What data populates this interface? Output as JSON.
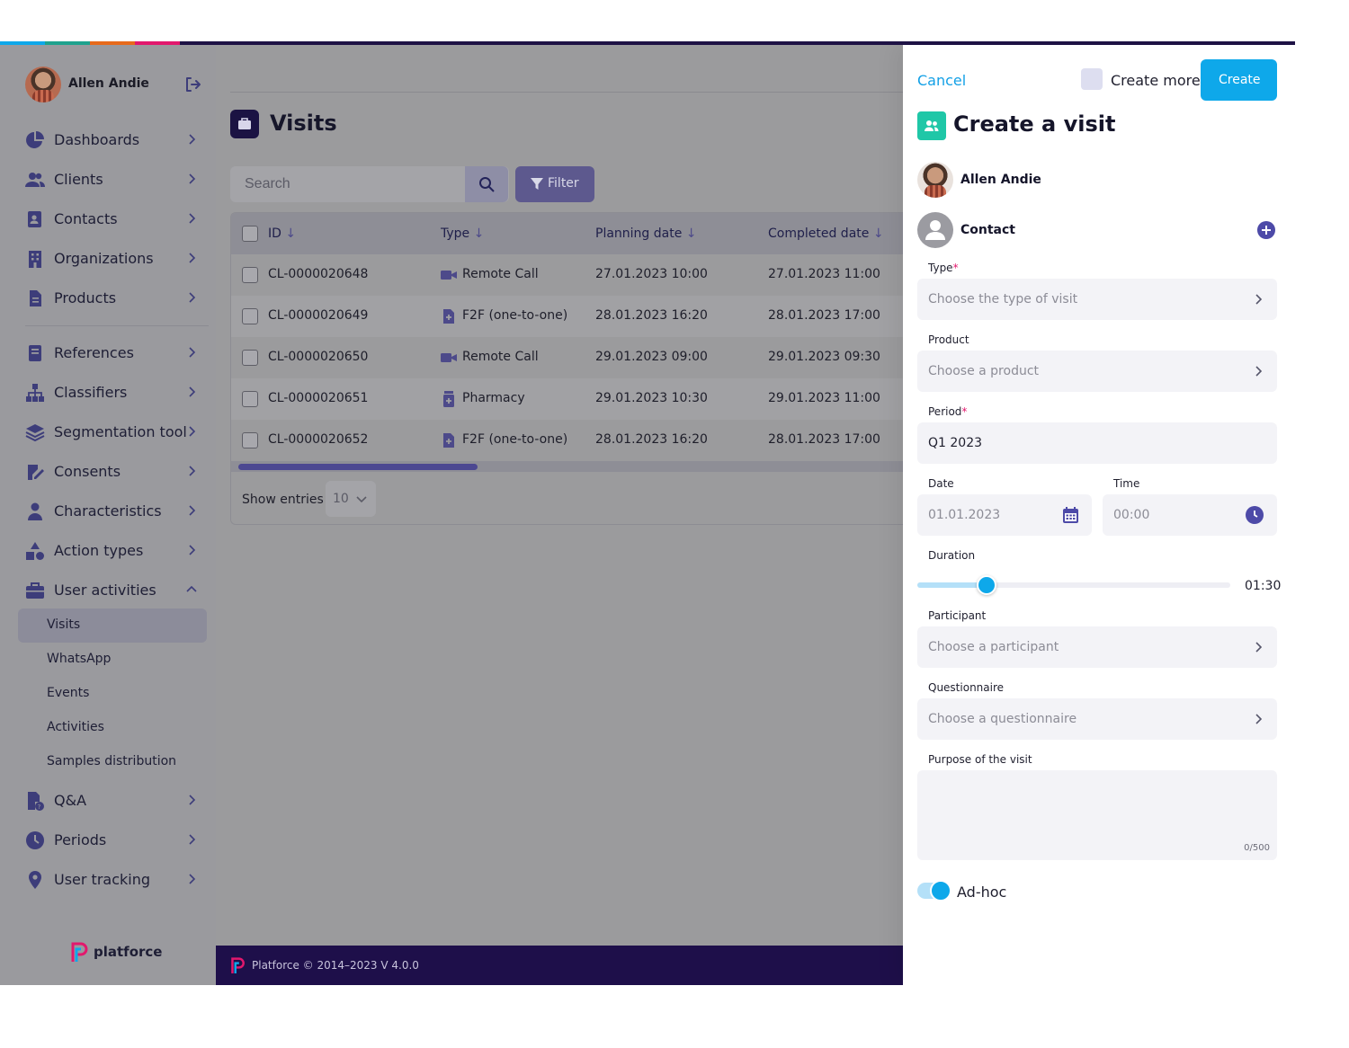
{
  "colors": {
    "accent": "#0ea8ea",
    "brand_dark": "#1e0f4a",
    "overlay_gray": "#9b9b9d",
    "teal_icon": "#1fc7a7",
    "required": "#e2186d"
  },
  "sidebar": {
    "user_name": "Allen Andie",
    "items": [
      {
        "label": "Dashboards",
        "icon": "pie-chart-icon"
      },
      {
        "label": "Clients",
        "icon": "users-icon"
      },
      {
        "label": "Contacts",
        "icon": "contact-card-icon"
      },
      {
        "label": "Organizations",
        "icon": "building-icon"
      },
      {
        "label": "Products",
        "icon": "document-icon"
      },
      {
        "label": "References",
        "icon": "book-icon"
      },
      {
        "label": "Classifiers",
        "icon": "hierarchy-icon"
      },
      {
        "label": "Segmentation tool",
        "icon": "layers-icon"
      },
      {
        "label": "Consents",
        "icon": "signature-icon"
      },
      {
        "label": "Characteristics",
        "icon": "person-icon"
      },
      {
        "label": "Action types",
        "icon": "shapes-icon"
      },
      {
        "label": "User activities",
        "icon": "briefcase-icon"
      }
    ],
    "subitems": [
      {
        "label": "Visits",
        "active": true
      },
      {
        "label": "WhatsApp"
      },
      {
        "label": "Events"
      },
      {
        "label": "Activities"
      },
      {
        "label": "Samples distribution"
      }
    ],
    "items_after": [
      {
        "label": "Q&A",
        "icon": "qa-file-icon"
      },
      {
        "label": "Periods",
        "icon": "clock-icon"
      },
      {
        "label": "User tracking",
        "icon": "location-pin-icon"
      }
    ],
    "brand": "platforce"
  },
  "main": {
    "title": "Visits",
    "search_placeholder": "Search",
    "filter_label": "Filter",
    "columns": [
      "ID",
      "Type",
      "Planning date",
      "Completed date"
    ],
    "rows": [
      {
        "id": "CL-0000020648",
        "type": "Remote Call",
        "type_icon": "video-icon",
        "planning": "27.01.2023 10:00",
        "completed": "27.01.2023 11:00"
      },
      {
        "id": "CL-0000020649",
        "type": "F2F (one-to-one)",
        "type_icon": "medical-file-icon",
        "planning": "28.01.2023 16:20",
        "completed": "28.01.2023 17:00"
      },
      {
        "id": "CL-0000020650",
        "type": "Remote Call",
        "type_icon": "video-icon",
        "planning": "29.01.2023 09:00",
        "completed": "29.01.2023 09:30"
      },
      {
        "id": "CL-0000020651",
        "type": "Pharmacy",
        "type_icon": "pill-bottle-icon",
        "planning": "29.01.2023 10:30",
        "completed": "29.01.2023 11:00"
      },
      {
        "id": "CL-0000020652",
        "type": "F2F (one-to-one)",
        "type_icon": "medical-file-icon",
        "planning": "28.01.2023 16:20",
        "completed": "28.01.2023 17:00"
      }
    ],
    "show_entries_label": "Show entries",
    "entries_value": "10",
    "footer": "Platforce © 2014–2023 V 4.0.0"
  },
  "panel": {
    "cancel": "Cancel",
    "create_more": "Create more",
    "create": "Create",
    "title": "Create a visit",
    "user_name": "Allen Andie",
    "contact_label": "Contact",
    "type_label": "Type",
    "type_placeholder": "Choose the type of visit",
    "product_label": "Product",
    "product_placeholder": "Choose a product",
    "period_label": "Period",
    "period_value": "Q1 2023",
    "date_label": "Date",
    "date_value": "01.01.2023",
    "time_label": "Time",
    "time_value": "00:00",
    "duration_label": "Duration",
    "duration_value": "01:30",
    "duration_fraction": 0.22,
    "participant_label": "Participant",
    "participant_placeholder": "Choose a participant",
    "questionnaire_label": "Questionnaire",
    "questionnaire_placeholder": "Choose a questionnaire",
    "purpose_label": "Purpose of the visit",
    "purpose_count": "0/500",
    "adhoc_label": "Ad-hoc",
    "adhoc_on": true
  }
}
